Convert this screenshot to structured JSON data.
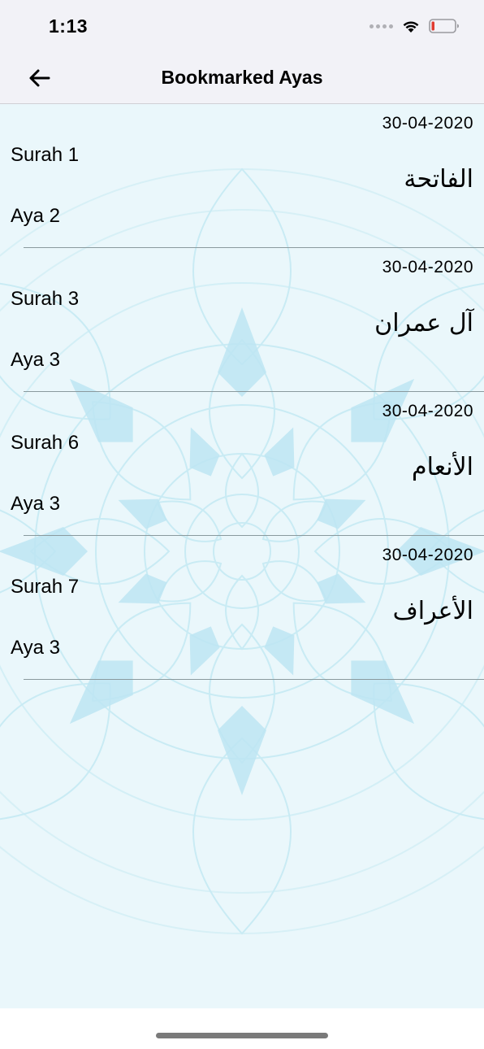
{
  "status_bar": {
    "time": "1:13",
    "icons": [
      "signal-dots-icon",
      "wifi-icon",
      "battery-low-icon"
    ]
  },
  "nav": {
    "back_icon": "arrow-left-icon",
    "title": "Bookmarked Ayas"
  },
  "bookmarks": [
    {
      "date": "30-04-2020",
      "surah": "Surah 1",
      "aya": "Aya 2",
      "surah_name": "الفاتحة"
    },
    {
      "date": "30-04-2020",
      "surah": "Surah 3",
      "aya": "Aya 3",
      "surah_name": "آل عمران"
    },
    {
      "date": "30-04-2020",
      "surah": "Surah 6",
      "aya": "Aya 3",
      "surah_name": "الأنعام"
    },
    {
      "date": "30-04-2020",
      "surah": "Surah 7",
      "aya": "Aya 3",
      "surah_name": "الأعراف"
    }
  ],
  "colors": {
    "background_tint": "#eaf7fb",
    "pattern": "#bde6f2",
    "bar": "#f2f2f7"
  }
}
